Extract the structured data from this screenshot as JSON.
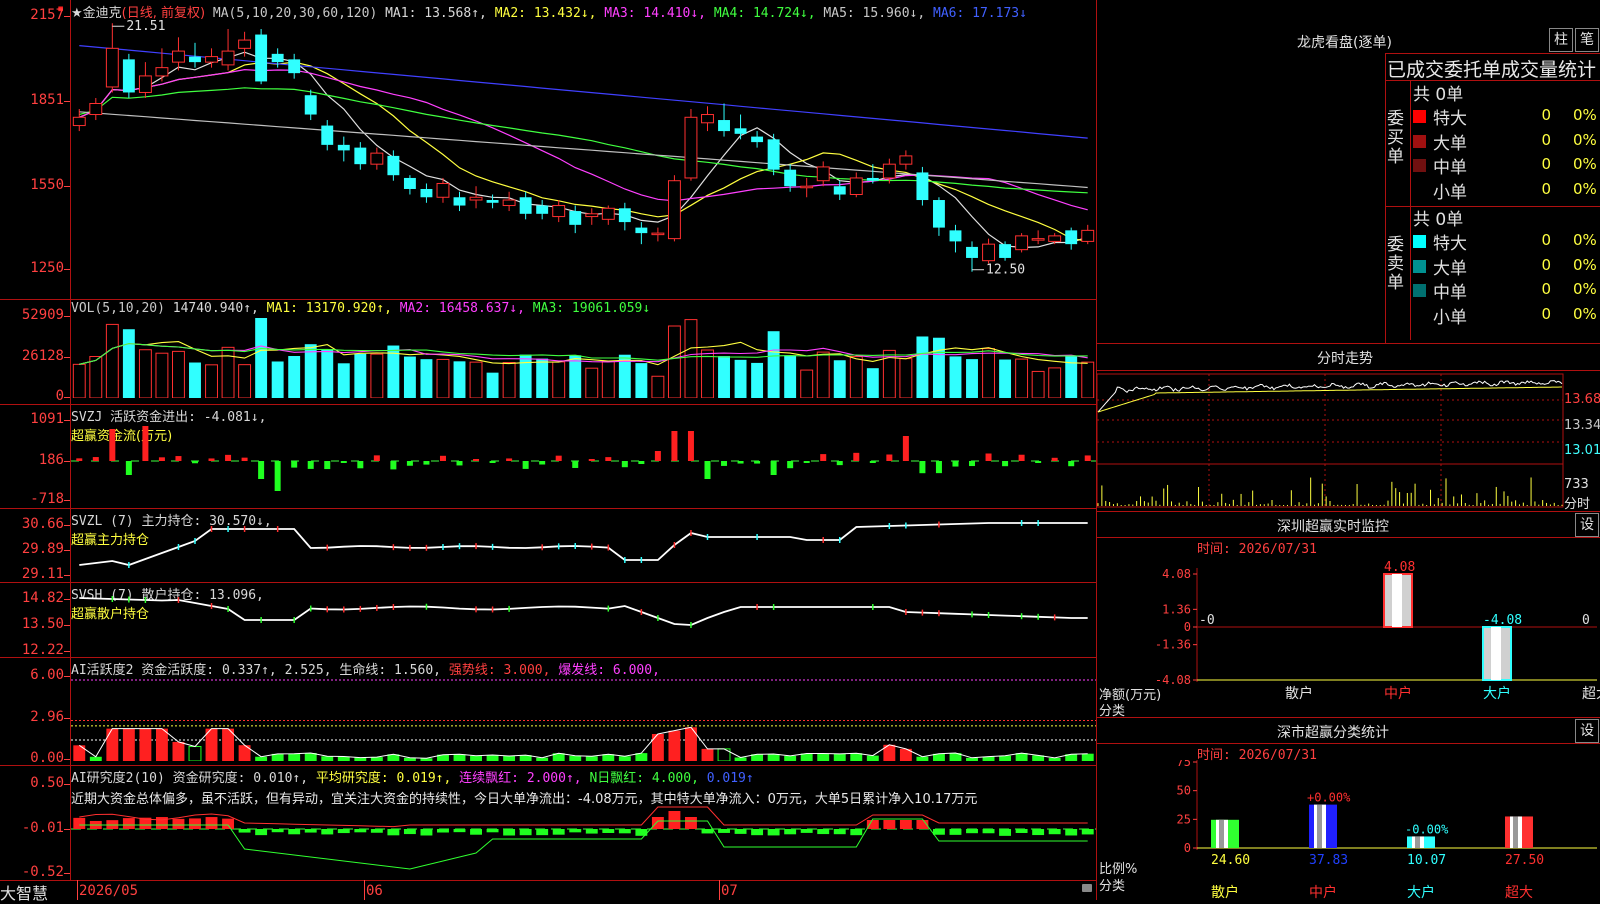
{
  "app_name": "大智慧",
  "main_header": {
    "stock": "★金迪克",
    "mode": "(日线, 前复权)",
    "ma_params": "MA(5,10,20,30,60,120)",
    "ma1": "MA1: 13.568↑,",
    "ma2": "MA2: 13.432↓,",
    "ma3": "MA3: 14.410↓,",
    "ma4": "MA4: 14.724↓,",
    "ma5": "MA5: 15.960↓,",
    "ma6": "MA6: 17.173↓"
  },
  "price_axis": [
    "2157",
    "1851",
    "1550",
    "1250"
  ],
  "price_annot_high": "21.51",
  "price_annot_low": "12.50",
  "vol_header": {
    "title": "VOL(5,10,20)",
    "value": "14740.940↑,",
    "ma1": "MA1: 13170.920↑,",
    "ma2": "MA2: 16458.637↓,",
    "ma3": "MA3: 19061.059↓"
  },
  "vol_axis": [
    "52909",
    "26128",
    "0"
  ],
  "svzj_header": {
    "title": "SVZJ  活跃资金进出: -4.081↓,",
    "subtitle": "超赢资金流(万元)"
  },
  "svzj_axis": [
    "1091",
    "186",
    "-718"
  ],
  "svzl_header": {
    "title": "SVZL (7) 主力持仓: 30.570↓,",
    "subtitle": "超赢主力持仓"
  },
  "svzl_axis": [
    "30.66",
    "29.89",
    "29.11"
  ],
  "svsh_header": {
    "title": "SVSH (7) 散户持仓: 13.096,",
    "subtitle": "超赢散户持仓"
  },
  "svsh_axis": [
    "14.82",
    "13.50",
    "12.22"
  ],
  "ai1_header": {
    "title": "AI活跃度2 资金活跃度: 0.337↑, 2.525,",
    "life": "生命线: 1.560,",
    "strong": "强势线: 3.000,",
    "burst": "爆发线: 6.000,"
  },
  "ai1_axis": [
    "6.00",
    "2.96",
    "0.00"
  ],
  "ai2_header": {
    "title": "AI研究度2(10) 资金研究度: 0.010↑,",
    "avg": "平均研究度: 0.019↑,",
    "cont": "连续飘红: 2.000↑,",
    "nday": "N日飘红: 4.000,",
    "last": "0.019↑"
  },
  "ai2_comment": "近期大资金总体偏多，虽不活跃，但有异动，宜关注大资金的持续性，今日大单净流出：-4.08万元，其中特大单净流入：0万元，大单5日累计净入10.17万元",
  "ai2_axis": [
    "0.50",
    "-0.01",
    "-0.52"
  ],
  "date_axis": [
    "2026/05",
    "06",
    "07"
  ],
  "dragon": {
    "title": "龙虎看盘(逐单)",
    "btn_zhu": "柱",
    "btn_bi": "笔",
    "subtitle": "已成交委托单成交量统计",
    "buy_label": "委买单",
    "buy_total": "共 0单",
    "sell_label": "委卖单",
    "sell_total": "共 0单",
    "buy_rows": [
      {
        "label": "特大",
        "value": "0",
        "pct": "0%",
        "color": "#ff0000"
      },
      {
        "label": "大单",
        "value": "0",
        "pct": "0%",
        "color": "#a01010"
      },
      {
        "label": "中单",
        "value": "0",
        "pct": "0%",
        "color": "#701010"
      },
      {
        "label": "小单",
        "value": "0",
        "pct": "0%",
        "color": "#000000"
      }
    ],
    "sell_rows": [
      {
        "label": "特大",
        "value": "0",
        "pct": "0%",
        "color": "#00ffff"
      },
      {
        "label": "大单",
        "value": "0",
        "pct": "0%",
        "color": "#009090"
      },
      {
        "label": "中单",
        "value": "0",
        "pct": "0%",
        "color": "#007070"
      },
      {
        "label": "小单",
        "value": "0",
        "pct": "0%",
        "color": "#000000"
      }
    ]
  },
  "intraday": {
    "title": "分时走势",
    "axis": [
      "13.68",
      "13.34",
      "13.01"
    ],
    "vol_label": "733",
    "unit": "分时"
  },
  "monitor": {
    "title": "深圳超赢实时监控",
    "settings": "设",
    "time": "时间: 2026/07/31",
    "axis": [
      "4.08",
      "1.36",
      "0",
      "-1.36",
      "-4.08"
    ],
    "ylabel": "净额(万元)",
    "xlabel": "分类",
    "categories": [
      "散户",
      "中户",
      "大户",
      "超大"
    ],
    "values": [
      0,
      4.08,
      -4.08,
      0
    ],
    "value_labels": [
      "-0",
      "4.08",
      "-4.08",
      "0"
    ]
  },
  "classify": {
    "title": "深市超赢分类统计",
    "settings": "设",
    "time": "时间: 2026/07/31",
    "axis": [
      "75",
      "50",
      "25",
      "0"
    ],
    "ylabel": "比例%",
    "xlabel": "分类",
    "categories": [
      "散户",
      "中户",
      "大户",
      "超大"
    ],
    "values": [
      24.6,
      37.83,
      10.07,
      27.5
    ],
    "value_labels": [
      "24.60",
      "37.83",
      "10.07",
      "27.50"
    ],
    "change_labels": [
      "",
      "+0.00%",
      "-0.00%",
      ""
    ]
  },
  "chart_data": {
    "type": "candlestick",
    "title": "",
    "x_ticks": [
      "2026/05",
      "06",
      "07"
    ],
    "ylim": [
      12.22,
      21.57
    ],
    "candles": [
      {
        "o": 17.8,
        "c": 18.1,
        "h": 18.4,
        "l": 17.6
      },
      {
        "o": 18.2,
        "c": 18.6,
        "h": 18.8,
        "l": 18.0
      },
      {
        "o": 19.2,
        "c": 20.6,
        "h": 21.51,
        "l": 19.0
      },
      {
        "o": 20.2,
        "c": 19.0,
        "h": 20.4,
        "l": 18.8
      },
      {
        "o": 19.0,
        "c": 19.6,
        "h": 20.1,
        "l": 18.8
      },
      {
        "o": 19.6,
        "c": 19.9,
        "h": 20.6,
        "l": 19.4
      },
      {
        "o": 20.1,
        "c": 20.5,
        "h": 21.0,
        "l": 19.8
      },
      {
        "o": 20.3,
        "c": 20.1,
        "h": 20.8,
        "l": 19.9
      },
      {
        "o": 20.1,
        "c": 20.3,
        "h": 20.6,
        "l": 19.9
      },
      {
        "o": 20.0,
        "c": 20.5,
        "h": 21.3,
        "l": 19.8
      },
      {
        "o": 20.6,
        "c": 20.9,
        "h": 21.2,
        "l": 20.3
      },
      {
        "o": 21.1,
        "c": 19.4,
        "h": 21.3,
        "l": 19.3
      },
      {
        "o": 20.4,
        "c": 20.1,
        "h": 20.6,
        "l": 19.9
      },
      {
        "o": 20.2,
        "c": 19.7,
        "h": 20.4,
        "l": 19.5
      },
      {
        "o": 18.9,
        "c": 18.2,
        "h": 19.1,
        "l": 18.0
      },
      {
        "o": 17.8,
        "c": 17.1,
        "h": 18.0,
        "l": 16.9
      },
      {
        "o": 17.1,
        "c": 16.9,
        "h": 17.4,
        "l": 16.5
      },
      {
        "o": 17.0,
        "c": 16.4,
        "h": 17.2,
        "l": 16.2
      },
      {
        "o": 16.4,
        "c": 16.8,
        "h": 17.0,
        "l": 16.2
      },
      {
        "o": 16.7,
        "c": 16.0,
        "h": 16.9,
        "l": 15.8
      },
      {
        "o": 15.9,
        "c": 15.5,
        "h": 16.0,
        "l": 15.3
      },
      {
        "o": 15.5,
        "c": 15.2,
        "h": 15.7,
        "l": 15.0
      },
      {
        "o": 15.2,
        "c": 15.7,
        "h": 15.9,
        "l": 15.0
      },
      {
        "o": 15.2,
        "c": 14.9,
        "h": 15.4,
        "l": 14.7
      },
      {
        "o": 15.1,
        "c": 15.2,
        "h": 15.6,
        "l": 14.8
      },
      {
        "o": 15.1,
        "c": 15.0,
        "h": 15.3,
        "l": 14.8
      },
      {
        "o": 14.9,
        "c": 15.1,
        "h": 15.4,
        "l": 14.7
      },
      {
        "o": 15.2,
        "c": 14.6,
        "h": 15.4,
        "l": 14.4
      },
      {
        "o": 14.9,
        "c": 14.6,
        "h": 15.1,
        "l": 14.4
      },
      {
        "o": 14.5,
        "c": 14.9,
        "h": 15.1,
        "l": 14.3
      },
      {
        "o": 14.7,
        "c": 14.2,
        "h": 14.9,
        "l": 13.9
      },
      {
        "o": 14.5,
        "c": 14.6,
        "h": 14.8,
        "l": 14.2
      },
      {
        "o": 14.4,
        "c": 14.8,
        "h": 14.9,
        "l": 14.2
      },
      {
        "o": 14.8,
        "c": 14.3,
        "h": 15.0,
        "l": 14.0
      },
      {
        "o": 14.1,
        "c": 13.9,
        "h": 14.3,
        "l": 13.5
      },
      {
        "o": 13.9,
        "c": 13.9,
        "h": 14.1,
        "l": 13.6
      },
      {
        "o": 13.7,
        "c": 15.8,
        "h": 16.0,
        "l": 13.6
      },
      {
        "o": 15.9,
        "c": 18.1,
        "h": 18.4,
        "l": 15.8
      },
      {
        "o": 17.9,
        "c": 18.2,
        "h": 18.5,
        "l": 17.6
      },
      {
        "o": 18.0,
        "c": 17.6,
        "h": 18.6,
        "l": 17.4
      },
      {
        "o": 17.7,
        "c": 17.5,
        "h": 18.2,
        "l": 17.3
      },
      {
        "o": 17.4,
        "c": 17.2,
        "h": 17.6,
        "l": 17.0
      },
      {
        "o": 17.3,
        "c": 16.2,
        "h": 17.5,
        "l": 16.0
      },
      {
        "o": 16.2,
        "c": 15.6,
        "h": 16.4,
        "l": 15.4
      },
      {
        "o": 15.6,
        "c": 15.6,
        "h": 15.9,
        "l": 15.2
      },
      {
        "o": 15.8,
        "c": 16.3,
        "h": 16.5,
        "l": 15.6
      },
      {
        "o": 15.6,
        "c": 15.3,
        "h": 15.8,
        "l": 15.1
      },
      {
        "o": 15.3,
        "c": 15.9,
        "h": 16.1,
        "l": 15.2
      },
      {
        "o": 15.9,
        "c": 15.8,
        "h": 16.4,
        "l": 15.7
      },
      {
        "o": 15.9,
        "c": 16.4,
        "h": 16.6,
        "l": 15.7
      },
      {
        "o": 16.4,
        "c": 16.7,
        "h": 16.9,
        "l": 16.2
      },
      {
        "o": 16.1,
        "c": 15.1,
        "h": 16.3,
        "l": 14.9
      },
      {
        "o": 15.1,
        "c": 14.1,
        "h": 15.2,
        "l": 13.8
      },
      {
        "o": 14.0,
        "c": 13.6,
        "h": 14.2,
        "l": 13.2
      },
      {
        "o": 13.4,
        "c": 13.0,
        "h": 13.6,
        "l": 12.5
      },
      {
        "o": 12.9,
        "c": 13.5,
        "h": 13.7,
        "l": 12.8
      },
      {
        "o": 13.5,
        "c": 13.0,
        "h": 13.6,
        "l": 12.9
      },
      {
        "o": 13.3,
        "c": 13.8,
        "h": 13.9,
        "l": 13.2
      },
      {
        "o": 13.7,
        "c": 13.7,
        "h": 14.0,
        "l": 13.5
      },
      {
        "o": 13.6,
        "c": 13.8,
        "h": 13.9,
        "l": 13.5
      },
      {
        "o": 14.0,
        "c": 13.5,
        "h": 14.1,
        "l": 13.3
      },
      {
        "o": 13.6,
        "c": 14.0,
        "h": 14.2,
        "l": 13.5
      }
    ]
  }
}
